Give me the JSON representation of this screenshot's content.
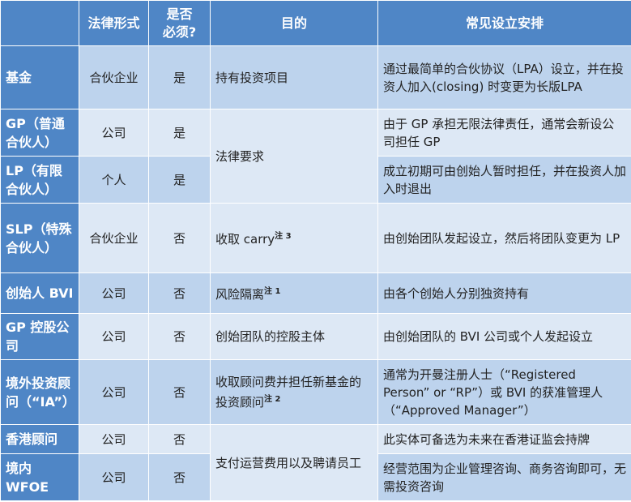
{
  "headers": {
    "entity": "",
    "legal_form": "法律形式",
    "required": "是否必须?",
    "purpose": "目的",
    "arrangement": "常见设立安排"
  },
  "rows": [
    {
      "entity": "基金",
      "legal_form": "合伙企业",
      "required": "是",
      "purpose": "持有投资项目",
      "purpose_note": "",
      "arrangement": "通过最简单的合伙协议（LPA）设立，并在投资人加入(closing) 时变更为长版LPA"
    },
    {
      "entity": "GP（普通合伙人）",
      "legal_form": "公司",
      "required": "是",
      "purpose": "法律要求",
      "purpose_note": "",
      "arrangement": "由于 GP 承担无限法律责任，通常会新设公司担任 GP"
    },
    {
      "entity": "LP（有限合伙人）",
      "legal_form": "个人",
      "required": "是",
      "purpose": "",
      "purpose_note": "",
      "arrangement": "成立初期可由创始人暂时担任，并在投资人加入时退出"
    },
    {
      "entity": "SLP（特殊合伙人）",
      "legal_form": "合伙企业",
      "required": "否",
      "purpose": "收取 carry",
      "purpose_note": "注 3",
      "arrangement": "由创始团队发起设立，然后将团队变更为 LP"
    },
    {
      "entity": "创始人 BVI",
      "legal_form": "公司",
      "required": "否",
      "purpose": "风险隔离",
      "purpose_note": "注 1",
      "arrangement": "由各个创始人分别独资持有"
    },
    {
      "entity": "GP 控股公司",
      "legal_form": "公司",
      "required": "否",
      "purpose": "创始团队的控股主体",
      "purpose_note": "",
      "arrangement": "由创始团队的 BVI 公司或个人发起设立"
    },
    {
      "entity": "境外投资顾问（“IA”）",
      "legal_form": "公司",
      "required": "否",
      "purpose": "收取顾问费并担任新基金的投资顾问",
      "purpose_note": "注 2",
      "arrangement": "通常为开曼注册人士（“Registered Person” or “RP”）或 BVI 的获准管理人（“Approved Manager”）"
    },
    {
      "entity": "香港顾问",
      "legal_form": "公司",
      "required": "否",
      "purpose": "支付运营费用以及聘请员工",
      "purpose_note": "",
      "arrangement": "此实体可备选为未来在香港证监会持牌"
    },
    {
      "entity": "境内 WFOE",
      "legal_form": "公司",
      "required": "否",
      "purpose": "",
      "purpose_note": "",
      "arrangement": "经营范围为企业管理咨询、商务咨询即可，无需投资咨询"
    }
  ]
}
